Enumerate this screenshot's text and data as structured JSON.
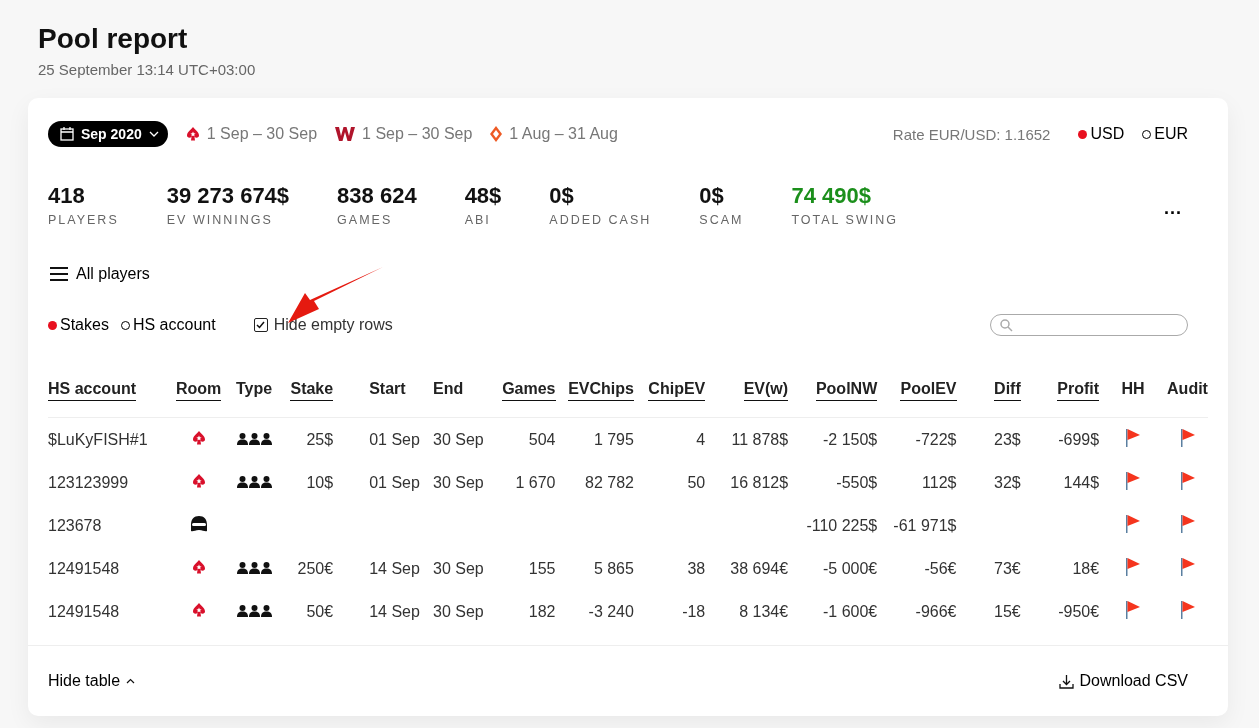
{
  "page": {
    "title": "Pool report",
    "subtitle": "25 September 13:14 UTC+03:00"
  },
  "filters": {
    "month": "Sep 2020",
    "ranges": [
      {
        "kind": "stars",
        "label": "1 Sep – 30 Sep"
      },
      {
        "kind": "winamax",
        "label": "1 Sep – 30 Sep"
      },
      {
        "kind": "party",
        "label": "1 Aug – 31 Aug"
      }
    ],
    "rate": "Rate EUR/USD: 1.1652",
    "currencies": [
      {
        "label": "USD",
        "selected": true
      },
      {
        "label": "EUR",
        "selected": false
      }
    ]
  },
  "stats": [
    {
      "value": "418",
      "label": "PLAYERS",
      "highlight": false
    },
    {
      "value": "39 273 674$",
      "label": "EV WINNINGS",
      "highlight": false
    },
    {
      "value": "838 624",
      "label": "GAMES",
      "highlight": false
    },
    {
      "value": "48$",
      "label": "ABI",
      "highlight": false
    },
    {
      "value": "0$",
      "label": "ADDED CASH",
      "highlight": false
    },
    {
      "value": "0$",
      "label": "SCAM",
      "highlight": false
    },
    {
      "value": "74 490$",
      "label": "TOTAL SWING",
      "highlight": true
    }
  ],
  "more_menu": "...",
  "player_filter": "All players",
  "group_by": [
    {
      "label": "Stakes",
      "selected": true
    },
    {
      "label": "HS account",
      "selected": false
    }
  ],
  "hide_empty_rows": {
    "label": "Hide empty rows",
    "checked": true
  },
  "table": {
    "columns": [
      {
        "label": "HS account",
        "sortable": true
      },
      {
        "label": "Room",
        "sortable": true
      },
      {
        "label": "Type",
        "sortable": false
      },
      {
        "label": "Stake",
        "sortable": true
      },
      {
        "label": "Start",
        "sortable": false
      },
      {
        "label": "End",
        "sortable": false
      },
      {
        "label": "Games",
        "sortable": true
      },
      {
        "label": "EVChips",
        "sortable": true
      },
      {
        "label": "ChipEV",
        "sortable": true
      },
      {
        "label": "EV(w)",
        "sortable": true
      },
      {
        "label": "PoolNW",
        "sortable": true
      },
      {
        "label": "PoolEV",
        "sortable": true
      },
      {
        "label": "Diff",
        "sortable": true
      },
      {
        "label": "Profit",
        "sortable": true
      },
      {
        "label": "HH",
        "sortable": false
      },
      {
        "label": "Audit",
        "sortable": false
      }
    ],
    "rows": [
      {
        "account": "$LuKyFISH#1",
        "room": {
          "kind": "stars"
        },
        "type": {
          "kind": "group"
        },
        "stake": "25$",
        "start": "01 Sep",
        "end": "30 Sep",
        "games": "504",
        "ev_chips": "1 795",
        "chip_ev": "4",
        "ev_w": "11 878$",
        "pool_nw": "-2 150$",
        "pool_ev": "-722$",
        "diff": "23$",
        "profit": "-699$"
      },
      {
        "account": "123123999",
        "room": {
          "kind": "stars"
        },
        "type": {
          "kind": "group"
        },
        "stake": "10$",
        "start": "01 Sep",
        "end": "30 Sep",
        "games": "1 670",
        "ev_chips": "82 782",
        "chip_ev": "50",
        "ev_w": "16 812$",
        "pool_nw": "-550$",
        "pool_ev": "112$",
        "diff": "32$",
        "profit": "144$"
      },
      {
        "account": "123678",
        "room": {
          "kind": "masked"
        },
        "pool_nw": "-110 225$",
        "pool_ev": "-61 971$"
      },
      {
        "account": "12491548",
        "room": {
          "kind": "stars"
        },
        "type": {
          "kind": "group"
        },
        "stake": "250€",
        "start": "14 Sep",
        "end": "30 Sep",
        "games": "155",
        "ev_chips": "5 865",
        "chip_ev": "38",
        "ev_w": "38 694€",
        "pool_nw": "-5 000€",
        "pool_ev": "-56€",
        "diff": "73€",
        "profit": "18€"
      },
      {
        "account": "12491548",
        "room": {
          "kind": "stars"
        },
        "type": {
          "kind": "group"
        },
        "stake": "50€",
        "start": "14 Sep",
        "end": "30 Sep",
        "games": "182",
        "ev_chips": "-3 240",
        "chip_ev": "-18",
        "ev_w": "8 134€",
        "pool_nw": "-1 600€",
        "pool_ev": "-966€",
        "diff": "15€",
        "profit": "-950€"
      }
    ]
  },
  "footer": {
    "toggle": "Hide table",
    "download": "Download CSV"
  }
}
